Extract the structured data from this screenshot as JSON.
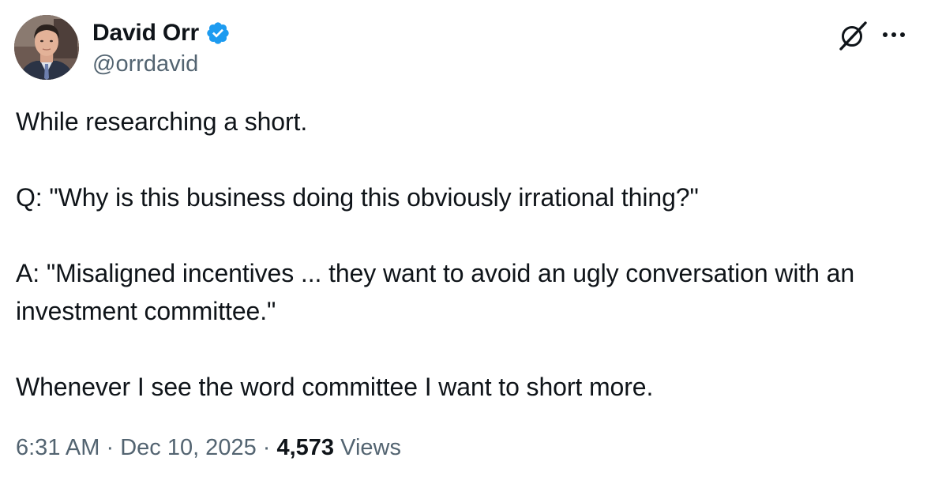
{
  "author": {
    "name": "David Orr",
    "handle": "@orrdavid",
    "verified": true,
    "avatar_icon": "profile-photo"
  },
  "actions": {
    "grok_icon": "grok-icon",
    "more_icon": "more-options-icon"
  },
  "tweet": {
    "paragraphs": [
      "While researching a short.",
      "Q: \"Why is this business doing this obviously irrational thing?\"",
      "A: \"Misaligned incentives ... they want to avoid an ugly conversation with an investment committee.\"",
      "Whenever I see the word committee I want to short more."
    ]
  },
  "meta": {
    "time": "6:31 AM",
    "separator": " · ",
    "date": "Dec 10, 2025",
    "views_count": "4,573",
    "views_label": "Views"
  },
  "colors": {
    "text_primary": "#0f1419",
    "text_secondary": "#536471",
    "verified_blue": "#1d9bf0"
  }
}
